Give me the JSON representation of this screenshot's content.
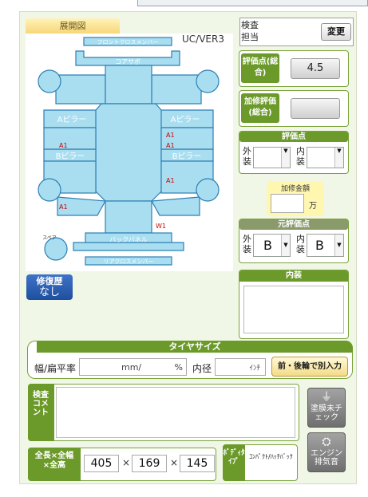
{
  "diagram": {
    "tab_label": "展開図",
    "version": "UC/VER3",
    "part_labels": {
      "front_cross_member": "フロントクロスメンバー",
      "core_support": "コアサポ",
      "a_pillar_left": "Aピラー",
      "a_pillar_right": "Aピラー",
      "b_pillar_left": "Bピラー",
      "b_pillar_right": "Bピラー",
      "back_panel": "バックパネル",
      "rear_cross_member": "リアクロスメンバー",
      "spare": "スペア"
    },
    "damage_marks": [
      "A1",
      "A1",
      "A1",
      "A1",
      "A1",
      "W1"
    ]
  },
  "inspector": {
    "label": "検査担当",
    "change_button": "変更"
  },
  "score_total": {
    "label": "評価点(総合)",
    "value": "4.5"
  },
  "repair_score": {
    "label": "加修評価(総合)",
    "value": ""
  },
  "score": {
    "header": "評価点",
    "exterior_label": "外装",
    "interior_label": "内装",
    "exterior_value": "",
    "interior_value": ""
  },
  "repair_amount": {
    "title": "加修金額",
    "value": "",
    "unit": "万"
  },
  "original_score": {
    "header": "元評価点",
    "exterior_label": "外装",
    "interior_label": "内装",
    "exterior_value": "B",
    "interior_value": "B"
  },
  "repair_history": {
    "label": "修復歴",
    "value": "なし"
  },
  "interior": {
    "header": "内装",
    "value": ""
  },
  "tire": {
    "header": "タイヤサイズ",
    "width_label": "幅/扁平率",
    "width_unit": "mm/",
    "ratio_unit": "%",
    "diameter_label": "内径",
    "diameter_unit": "ｲﾝﾁ",
    "front_rear_button": "前・後輪で別入力"
  },
  "comment": {
    "label": "検査コメント",
    "value": ""
  },
  "buttons": {
    "paint": "塗膜未チェック",
    "engine": "エンジン排気音"
  },
  "dimensions": {
    "label": "全長×全幅×全高",
    "length": "405",
    "width": "169",
    "height": "145",
    "separator": "×"
  },
  "body_type": {
    "label": "ﾎﾞﾃﾞｨﾀｲﾌﾟ",
    "value": "ｺﾝﾊﾟｸﾄ/ﾊｯﾁﾊﾞｯｸ"
  },
  "colors": {
    "panel": "#a8def0",
    "panel_stroke": "#2f7fb5",
    "damage": "#cc0000",
    "header_green": "#6b9a2a",
    "history_blue": "#2a5fb5"
  }
}
